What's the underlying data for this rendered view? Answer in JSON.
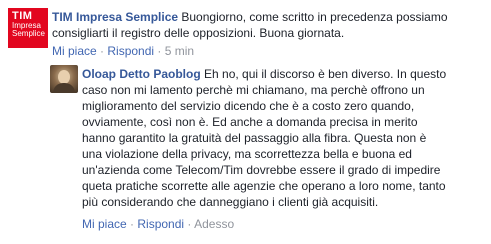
{
  "comment1": {
    "avatar_text_brand": "TIM",
    "avatar_text_line1": "Impresa",
    "avatar_text_line2": "Semplice",
    "author": "TIM Impresa Semplice",
    "text_line1": " Buongiorno, come scritto in precedenza possiamo",
    "text_line2": "consigliarti il registro delle opposizioni. Buona giornata.",
    "like_label": "Mi piace",
    "reply_label": "Rispondi",
    "timestamp": "5 min",
    "separator": "·"
  },
  "comment2": {
    "author": "Oloap Detto Paoblog",
    "lines": [
      " Eh no, qui il discorso è ben diverso. In questo",
      "caso non mi lamento perchè mi chiamano, ma perchè offrono un",
      "miglioramento del servizio dicendo che è a costo zero quando,",
      "ovviamente, così non è. Ed anche a domanda precisa in merito",
      "hanno garantito la gratuità del passaggio alla fibra. Questa non è",
      "una violazione della privacy, ma scorrettezza bella e buona ed",
      "un'azienda come Telecom/Tim dovrebbe essere il grado di impedire",
      "queta pratiche scorrette alle agenzie che operano a loro nome, tanto",
      "più considerando che danneggiano i clienti già acquisiti."
    ],
    "like_label": "Mi piace",
    "reply_label": "Rispondi",
    "timestamp": "Adesso",
    "separator": "·"
  }
}
